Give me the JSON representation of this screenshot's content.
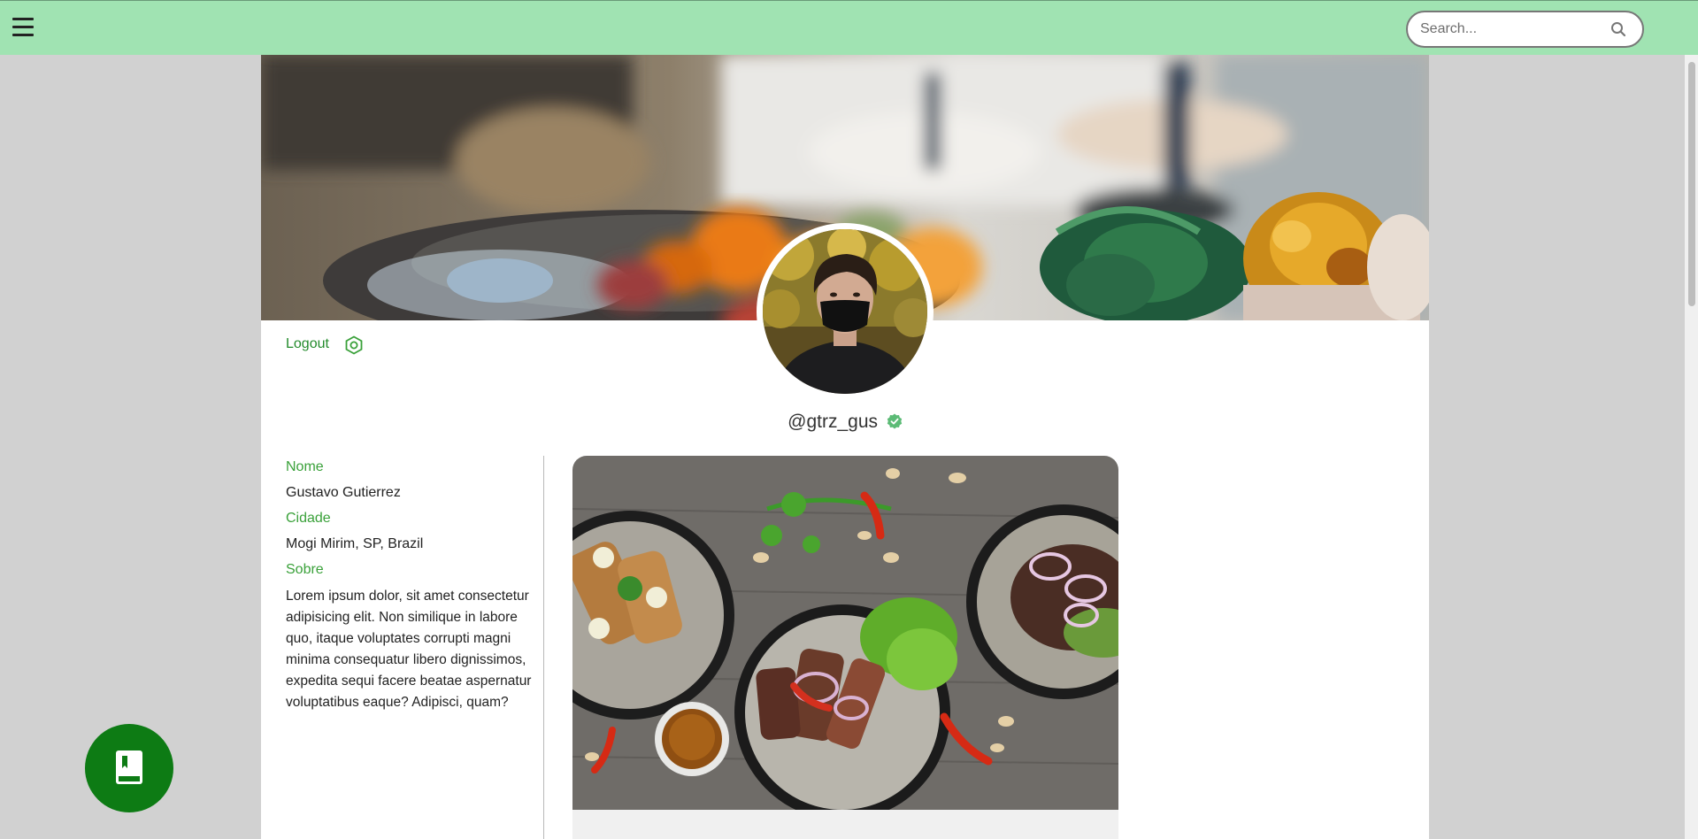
{
  "header": {
    "menu_icon": "hamburger-menu-icon",
    "search": {
      "placeholder": "Search...",
      "value": "",
      "icon": "search-icon"
    },
    "background_color": "#a0e3b2"
  },
  "profile": {
    "logout_label": "Logout",
    "settings_icon": "settings-hexagon-icon",
    "username": "@gtrz_gus",
    "verified_icon": "verified-check-icon",
    "fields": [
      {
        "label": "Nome",
        "value": "Gustavo Gutierrez"
      },
      {
        "label": "Cidade",
        "value": "Mogi Mirim, SP, Brazil"
      },
      {
        "label": "Sobre",
        "value": "Lorem ipsum dolor, sit amet consectetur adipisicing elit. Non similique in labore quo, itaque voluptates corrupti magni minima consequatur libero dignissimos, expedita sequi facere beatae aspernatur voluptatibus eaque? Adipisci, quam?"
      }
    ]
  },
  "fab": {
    "icon": "recipe-book-icon",
    "color": "#0d7b14"
  },
  "colors": {
    "accent": "#3aa13a",
    "link": "#238b2c",
    "page_bg": "#d1d1d1"
  }
}
